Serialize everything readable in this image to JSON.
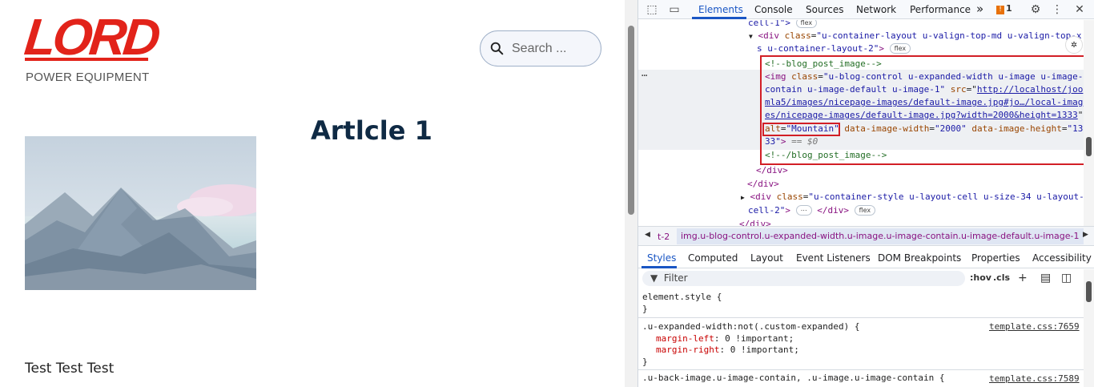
{
  "page": {
    "logo_word": "LORD",
    "logo_sub": "POWER EQUIPMENT",
    "search_placeholder": "Search ...",
    "article_title": "Artlcle 1",
    "image_alt": "Mountain",
    "body_text": "Test Test Test"
  },
  "devtools": {
    "tabs": [
      "Elements",
      "Console",
      "Sources",
      "Network",
      "Performance"
    ],
    "more_tabs": "»",
    "issues_count": "1",
    "elements": {
      "l0_tail": "cell-1\">",
      "flex": "flex",
      "l1_tag": "<div",
      "l1_attr": "class",
      "l1_val": "\"u-container-layout u-valign-top-md u-valign-top-x",
      "l1b_val": "s u-container-layout-2\"",
      "l1b_close": ">",
      "c1": "<!--blog_post_image-->",
      "img_open": "<img",
      "img_class_attr": "class",
      "img_class_val": "\"u-blog-control u-expanded-width u-image u-image-",
      "img_class_val2": "contain u-image-default u-image-1\"",
      "img_src_attr": "src",
      "img_src_val1": "http://localhost/joo",
      "img_src_val2": "mla5/images/nicepage-images/default-image.jpg#jo…/local-imag",
      "img_src_val3": "es/nicepage-images/default-image.jpg?width=2000&height=1333",
      "alt_attr": "alt",
      "alt_val": "\"Mountain\"",
      "dw_attr": "data-image-width",
      "dw_val": "\"2000\"",
      "dh_attr": "data-image-height",
      "dh_val": "\"13",
      "dh_val2": "33\"",
      "dollar": "== $0",
      "c2": "<!--/blog_post_image-->",
      "close_div1": "</div>",
      "close_div2": "</div>",
      "l_div_tag": "<div",
      "l_div_val": "\"u-container-style u-layout-cell u-size-34 u-layout-",
      "l_div_val2": "cell-2\"",
      "ellipsis": "⋯",
      "close_div3": "</div>",
      "cut": "</div>"
    },
    "breadcrumb": {
      "prev": "t-2",
      "current": "img.u-blog-control.u-expanded-width.u-image.u-image-contain.u-image-default.u-image-1"
    },
    "sub_tabs": [
      "Styles",
      "Computed",
      "Layout",
      "Event Listeners",
      "DOM Breakpoints",
      "Properties",
      "Accessibility"
    ],
    "filter_placeholder": "Filter",
    "hov": ":hov",
    "cls": ".cls",
    "styles": {
      "el_style": "element.style {",
      "brace_close": "}",
      "rule1_selector": ".u-expanded-width:not(.custom-expanded) {",
      "rule1_source": "template.css:7659",
      "rule1_p1_name": "margin-left",
      "rule1_p1_val": ": 0 !important;",
      "rule1_p2_name": "margin-right",
      "rule1_p2_val": ": 0 !important;",
      "rule2_selector": ".u-back-image.u-image-contain, .u-image.u-image-contain {",
      "rule2_source": "template.css:7589"
    }
  }
}
